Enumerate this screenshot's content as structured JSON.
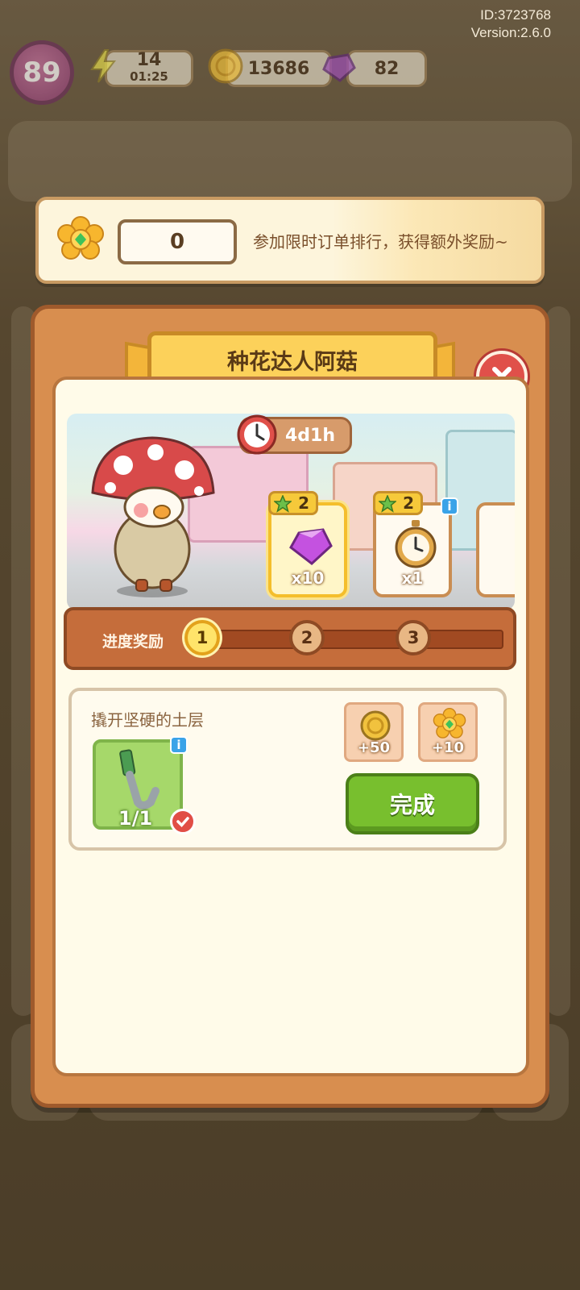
{
  "meta": {
    "id": "ID:3723768",
    "version": "Version:2.6.0"
  },
  "hud": {
    "level": "89",
    "energy": "14",
    "energy_timer": "01:25",
    "coins": "13686",
    "gems": "82"
  },
  "banner": {
    "flower_count": "0",
    "text": "参加限时订单排行，获得额外奖励~"
  },
  "panel": {
    "title": "种花达人阿菇",
    "timer": "4d1h",
    "rewards": [
      {
        "star": "2",
        "qty": "x10",
        "item": "gem-icon",
        "active": true
      },
      {
        "star": "2",
        "qty": "x1",
        "item": "stopwatch-icon",
        "active": false
      }
    ],
    "progress": {
      "label": "进度奖励",
      "steps": [
        "1",
        "2",
        "3"
      ],
      "current_step": 1
    },
    "task": {
      "title": "撬开坚硬的土层",
      "item_count": "1/1",
      "reward_coins": "+50",
      "reward_flowers": "+10",
      "complete_label": "完成"
    }
  },
  "colors": {
    "accent_green": "#78bf2e",
    "panel_orange": "#d88e4f",
    "close_red": "#e0504a",
    "gem_purple": "#b34fd6"
  }
}
